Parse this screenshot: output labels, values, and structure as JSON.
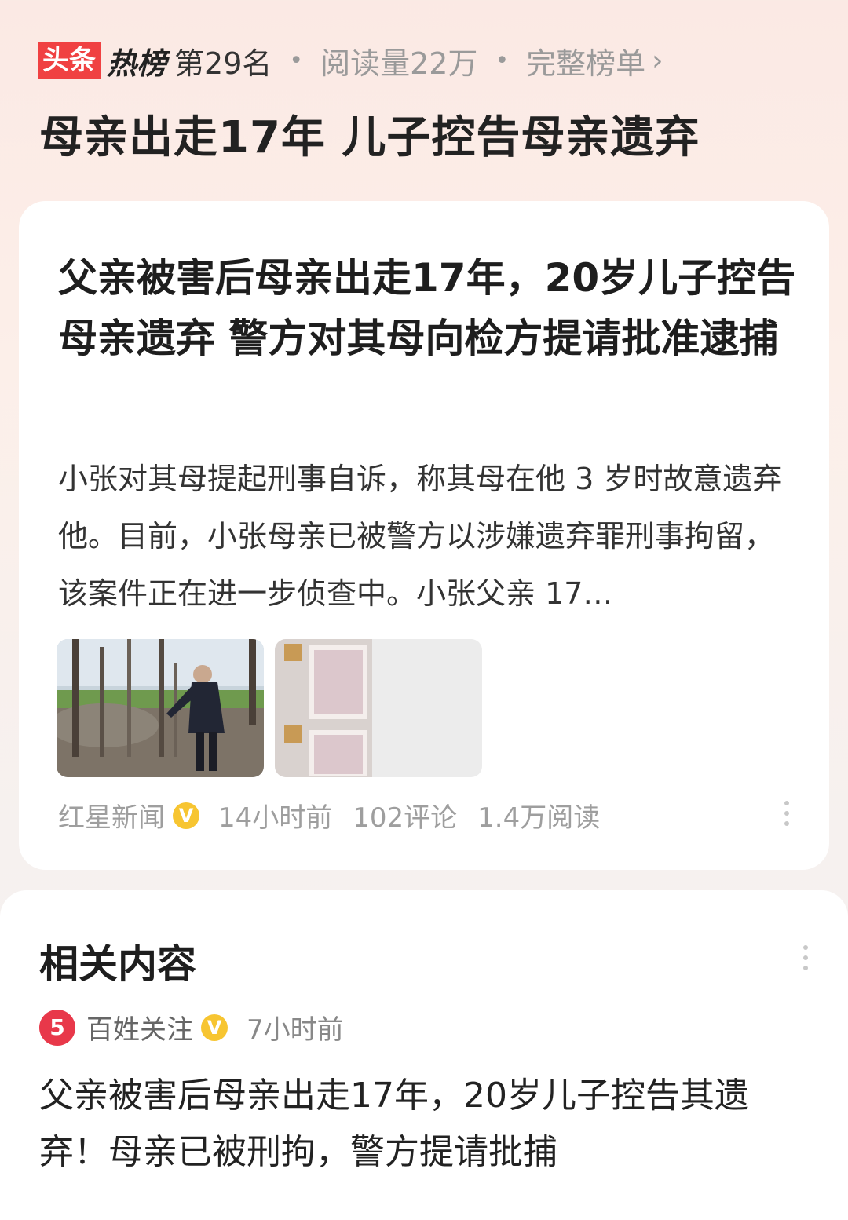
{
  "header": {
    "brand_box": "头条",
    "brand_hot": "热榜",
    "rank": "第29名",
    "reads": "阅读量22万",
    "full_list": "完整榜单",
    "headline": "母亲出走17年 儿子控告母亲遗弃"
  },
  "article": {
    "title": "父亲被害后母亲出走17年，20岁儿子控告母亲遗弃 警方对其母向检方提请批准逮捕",
    "summary": "小张对其母提起刑事自诉，称其母在他 3 岁时故意遗弃他。目前，小张母亲已被警方以涉嫌遗弃罪刑事拘留，该案件正在进一步侦查中。小张父亲 17…",
    "source": "红星新闻",
    "verified_badge": "V",
    "time": "14小时前",
    "comments": "102评论",
    "reads": "1.4万阅读"
  },
  "related": {
    "section_title": "相关内容",
    "source": "百姓关注",
    "verified_badge": "V",
    "time": "7小时前",
    "title": "父亲被害后母亲出走17年，20岁儿子控告其遗弃！母亲已被刑拘，警方提请批捕"
  },
  "colors": {
    "brand_red": "#f04142",
    "verified_gold": "#f7c531"
  },
  "icons": [
    "chevron-right-icon",
    "verified-icon",
    "more-icon",
    "source-logo-icon"
  ]
}
